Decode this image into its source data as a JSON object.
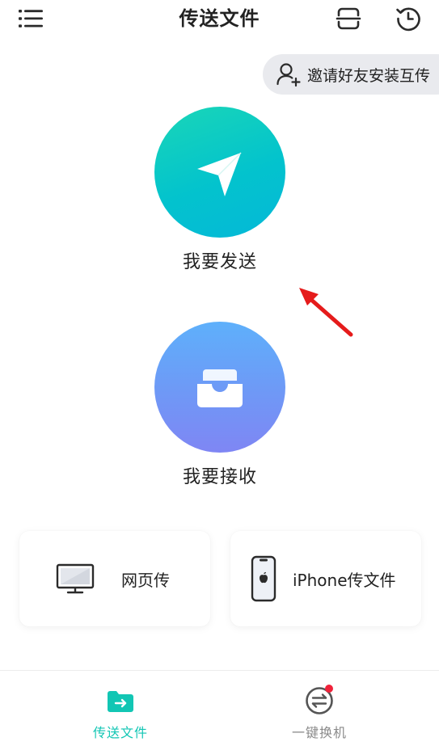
{
  "header": {
    "title": "传送文件",
    "left_icon": "menu-icon",
    "right_icons": [
      "scan-icon",
      "history-icon"
    ]
  },
  "invite": {
    "label": "邀请好友安装互传",
    "icon": "add-user-icon"
  },
  "actions": {
    "send": {
      "label": "我要发送",
      "icon": "paper-plane-icon"
    },
    "receive": {
      "label": "我要接收",
      "icon": "inbox-tray-icon"
    }
  },
  "cards": {
    "web": {
      "label": "网页传",
      "icon": "monitor-icon"
    },
    "iphone": {
      "label": "iPhone传文件",
      "icon": "iphone-icon"
    }
  },
  "bottom_nav": {
    "items": [
      {
        "label": "传送文件",
        "icon": "folder-transfer-icon",
        "active": true
      },
      {
        "label": "一键换机",
        "icon": "swap-arrows-icon",
        "active": false,
        "badge": true
      }
    ]
  },
  "colors": {
    "accent": "#12c6b4",
    "send_gradient": [
      "#1ad6b7",
      "#05b8d8"
    ],
    "receive_gradient": [
      "#5eb0fb",
      "#7f86f4"
    ],
    "annotation": "#e51b1b",
    "badge": "#f0223a",
    "inactive_text": "#8a8a8a"
  }
}
